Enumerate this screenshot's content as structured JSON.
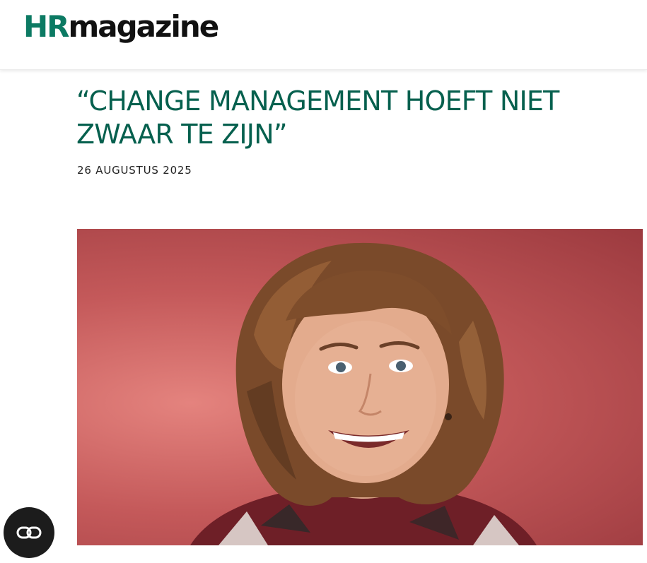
{
  "site": {
    "logo_hr": "HR",
    "logo_rest": "magazine"
  },
  "article": {
    "title": "“CHANGE MANAGEMENT HOEFT NIET ZWAAR TE ZIJN”",
    "date": "26 AUGUSTUS 2025",
    "hero_image": "portrait-photo"
  },
  "floating_button": {
    "icon": "link-icon"
  },
  "colors": {
    "brand_green": "#0c7a63",
    "headline_green": "#06604e",
    "photo_background": "#c4595a",
    "button_dark": "#1c1c1c"
  }
}
